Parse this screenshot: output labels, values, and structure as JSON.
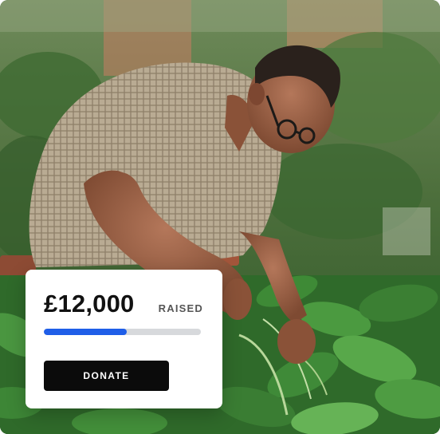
{
  "photo": {
    "subject": "man-tending-garden"
  },
  "fundraiser": {
    "amount": "£12,000",
    "raised_label": "RAISED",
    "progress_fraction": 0.53,
    "donate_label": "DONATE",
    "colors": {
      "accent": "#1f5ee8",
      "button": "#0b0b0b",
      "track": "#d7d9dc"
    }
  }
}
